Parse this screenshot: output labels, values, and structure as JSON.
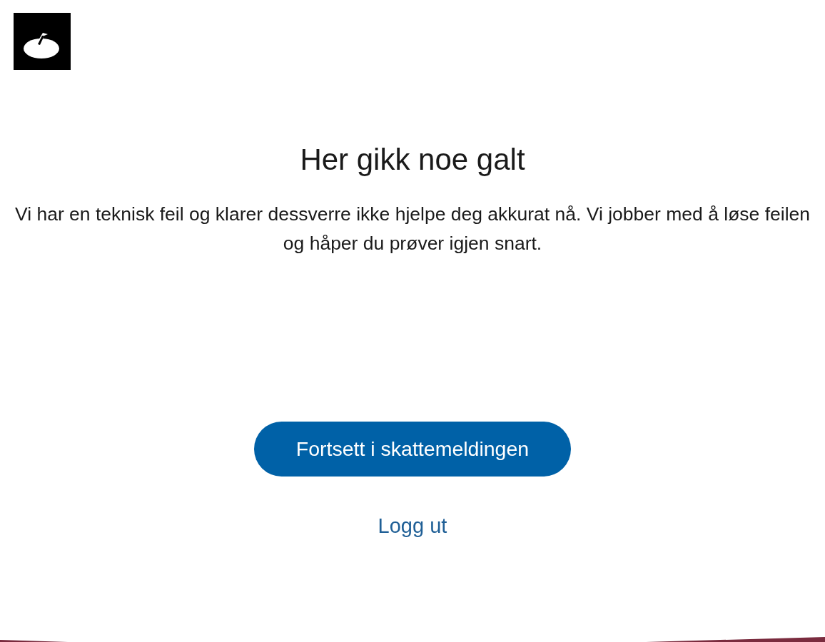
{
  "heading": "Her gikk noe galt",
  "message": "Vi har en teknisk feil og klarer dessverre ikke hjelpe deg akkurat nå. Vi jobber med å løse feilen og håper du prøver igjen snart.",
  "primary_button": "Fortsett i skattemeldingen",
  "link": "Logg ut"
}
